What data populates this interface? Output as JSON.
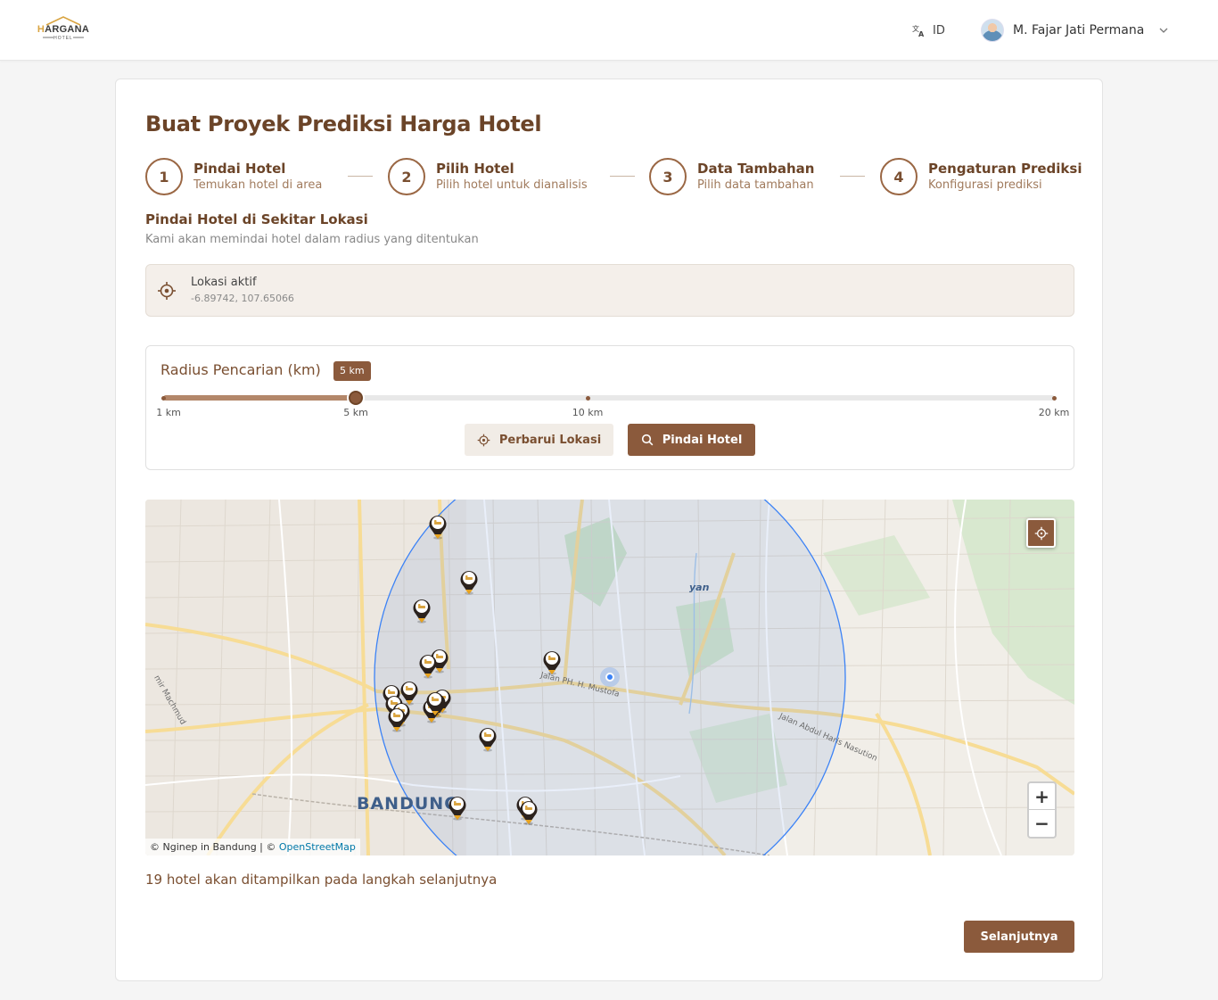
{
  "header": {
    "logo_text_h": "H",
    "logo_text_rest": "ARGANA",
    "logo_sub": "HOTEL",
    "language": "ID",
    "user_name": "M. Fajar Jati Permana"
  },
  "page": {
    "title": "Buat Proyek Prediksi Harga Hotel"
  },
  "steps": [
    {
      "number": "1",
      "title": "Pindai Hotel",
      "subtitle": "Temukan hotel di area"
    },
    {
      "number": "2",
      "title": "Pilih Hotel",
      "subtitle": "Pilih hotel untuk dianalisis"
    },
    {
      "number": "3",
      "title": "Data Tambahan",
      "subtitle": "Pilih data tambahan"
    },
    {
      "number": "4",
      "title": "Pengaturan Prediksi",
      "subtitle": "Konfigurasi prediksi"
    }
  ],
  "scan": {
    "title": "Pindai Hotel di Sekitar Lokasi",
    "subtitle": "Kami akan memindai hotel dalam radius yang ditentukan"
  },
  "location": {
    "label": "Lokasi aktif",
    "value": "-6.89742, 107.65066"
  },
  "radius": {
    "label": "Radius Pencarian (km)",
    "badge": "5 km",
    "selected_index": 1,
    "ticks": [
      "1 km",
      "5 km",
      "10 km",
      "20 km"
    ]
  },
  "buttons": {
    "refresh": "Perbarui Lokasi",
    "scan": "Pindai Hotel",
    "next": "Selanjutnya"
  },
  "map": {
    "city": "BANDUNG",
    "road_1": "Jalan PH. H. Mustofa",
    "road_2": "Jalan Abdul Haris Nasution",
    "road_3": "mir Machmud",
    "area_fragment": "yan",
    "attribution_prefix": "© Nginep in Bandung | © ",
    "attribution_link": "OpenStreetMap",
    "zoom_in": "+",
    "zoom_out": "−",
    "hotel_markers": 19
  },
  "summary": "19 hotel akan ditampilkan pada langkah selanjutnya",
  "colors": {
    "brand": "#8b5a3c",
    "brand_dark": "#6b4428",
    "radius_circle": "#3b82f6"
  }
}
